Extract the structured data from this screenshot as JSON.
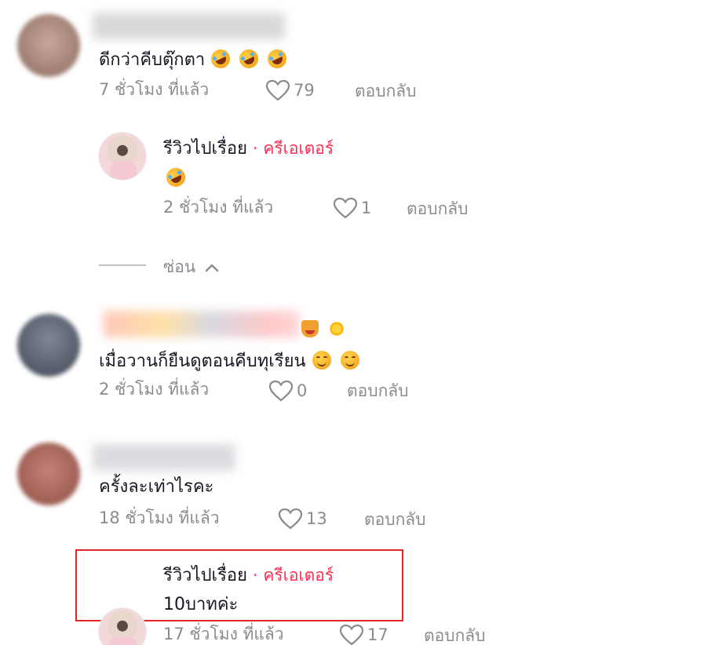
{
  "comments": [
    {
      "text": "ดีกว่าคีบตุ๊กตา",
      "time": "7 ชั่วโมง ที่แล้ว",
      "likes": "79",
      "reply_label": "ตอบกลับ",
      "emojis": [
        "rofl-emoji",
        "rofl-emoji",
        "rofl-emoji"
      ],
      "replies": [
        {
          "author": "รีวิวไปเรื่อย",
          "tag": "· ครีเอเตอร์",
          "time": "2 ชั่วโมง ที่แล้ว",
          "likes": "1",
          "reply_label": "ตอบกลับ",
          "emojis": [
            "rofl-emoji"
          ]
        }
      ],
      "hide_label": "ซ่อน"
    },
    {
      "text": "เมื่อวานก็ยืนดูตอนคีบทุเรียน",
      "time": "2 ชั่วโมง ที่แล้ว",
      "likes": "0",
      "reply_label": "ตอบกลับ",
      "name_emojis": [
        "cat-emoji",
        "sun-emoji"
      ],
      "emojis": [
        "smile-emoji",
        "smile-emoji"
      ]
    },
    {
      "text": "ครั้งละเท่าไรคะ",
      "time": "18 ชั่วโมง ที่แล้ว",
      "likes": "13",
      "reply_label": "ตอบกลับ",
      "replies": [
        {
          "author": "รีวิวไปเรื่อย",
          "tag": "· ครีเอเตอร์",
          "text": "10บาทค่ะ",
          "time": "17 ชั่วโมง ที่แล้ว",
          "likes": "17",
          "reply_label": "ตอบกลับ"
        }
      ]
    }
  ],
  "colors": {
    "creator_tag": "#fe2c55",
    "meta": "#8a8b91",
    "highlight": "#e02424"
  }
}
